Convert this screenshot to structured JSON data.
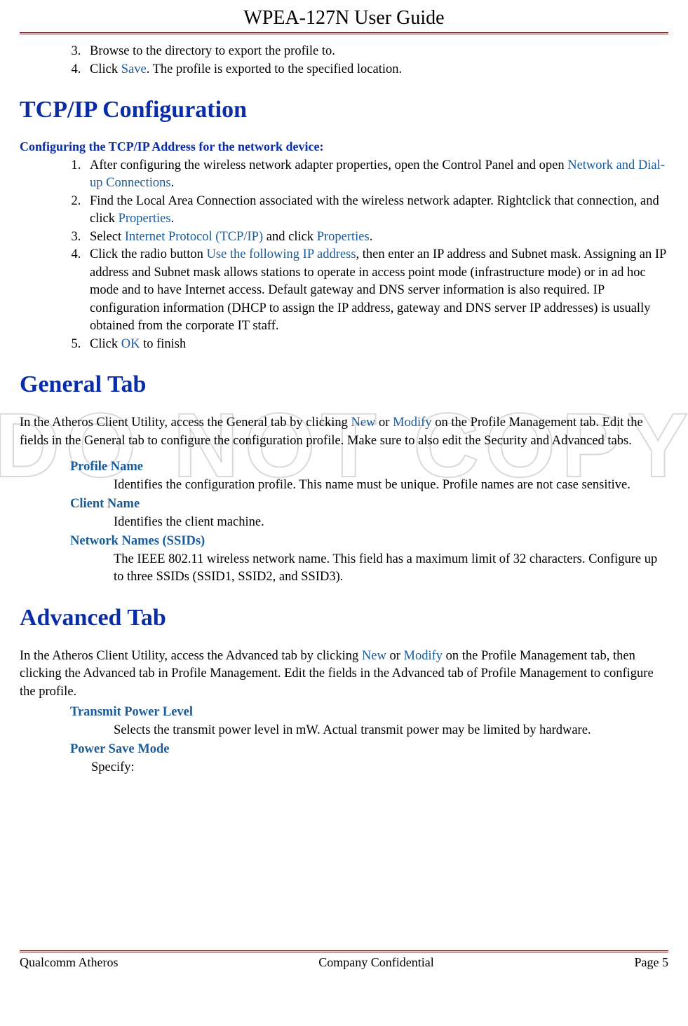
{
  "header": {
    "title": "WPEA-127N User Guide"
  },
  "watermark": "DO NOT COPY",
  "top_list": {
    "start": 3,
    "items": [
      {
        "text": "Browse to the directory to export the profile to."
      },
      {
        "pre": "Click ",
        "link": "Save",
        "post": ". The profile is exported to the specified location."
      }
    ]
  },
  "tcp": {
    "heading": "TCP/IP Configuration",
    "sub": "Configuring the TCP/IP Address for the network device:",
    "items": [
      {
        "pre": "After configuring the wireless network adapter properties, open the Control Panel and open ",
        "link": "Network and Dial-up Connections",
        "post": "."
      },
      {
        "pre": "Find the Local Area Connection associated with the wireless network adapter. Rightclick that connection, and click ",
        "link": "Properties",
        "post": "."
      },
      {
        "pre": "Select ",
        "link": "Internet Protocol (TCP/IP)",
        "mid": " and click ",
        "link2": "Properties",
        "post": "."
      },
      {
        "pre": "Click the radio button ",
        "link": "Use the following IP address",
        "post": ", then enter an IP address and Subnet mask. Assigning an IP address and Subnet mask allows stations to operate in access point mode (infrastructure mode) or in ad hoc mode and to have Internet access. Default gateway and DNS server information is also required. IP configuration information (DHCP to assign the IP address, gateway and DNS server IP addresses) is usually obtained from the corporate IT staff."
      },
      {
        "pre": "Click ",
        "link": "OK",
        "post": " to finish"
      }
    ]
  },
  "general": {
    "heading": "General Tab",
    "para_pre": "In the Atheros Client Utility, access the General tab by clicking ",
    "link1": "New",
    "mid1": " or ",
    "link2": "Modify",
    "para_post": " on the Profile Management tab. Edit the fields in the General tab to configure the configuration profile. Make sure to also edit the Security and Advanced tabs.",
    "defs": [
      {
        "term": "Profile Name",
        "desc": "Identifies the configuration profile. This name must be unique. Profile names are not case sensitive."
      },
      {
        "term": "Client Name",
        "desc": "Identifies the client machine."
      },
      {
        "term": "Network Names (SSIDs)",
        "desc": "The IEEE 802.11 wireless network name. This field has a maximum limit of 32 characters. Configure up to three SSIDs (SSID1, SSID2, and SSID3)."
      }
    ]
  },
  "advanced": {
    "heading": "Advanced Tab",
    "para_pre": "In the Atheros Client Utility, access the Advanced tab by clicking ",
    "link1": "New",
    "mid1": " or ",
    "link2": "Modify",
    "para_post": " on the Profile Management tab, then clicking the Advanced tab in Profile Management. Edit the fields in the Advanced tab of Profile Management to configure the profile.",
    "defs": [
      {
        "term": "Transmit Power Level",
        "desc": "Selects the transmit power level in mW. Actual transmit power may be limited by hardware."
      },
      {
        "term": "Power Save Mode",
        "desc": "Specify:"
      }
    ]
  },
  "footer": {
    "left": "Qualcomm Atheros",
    "center": "Company Confidential",
    "right": "Page 5"
  }
}
